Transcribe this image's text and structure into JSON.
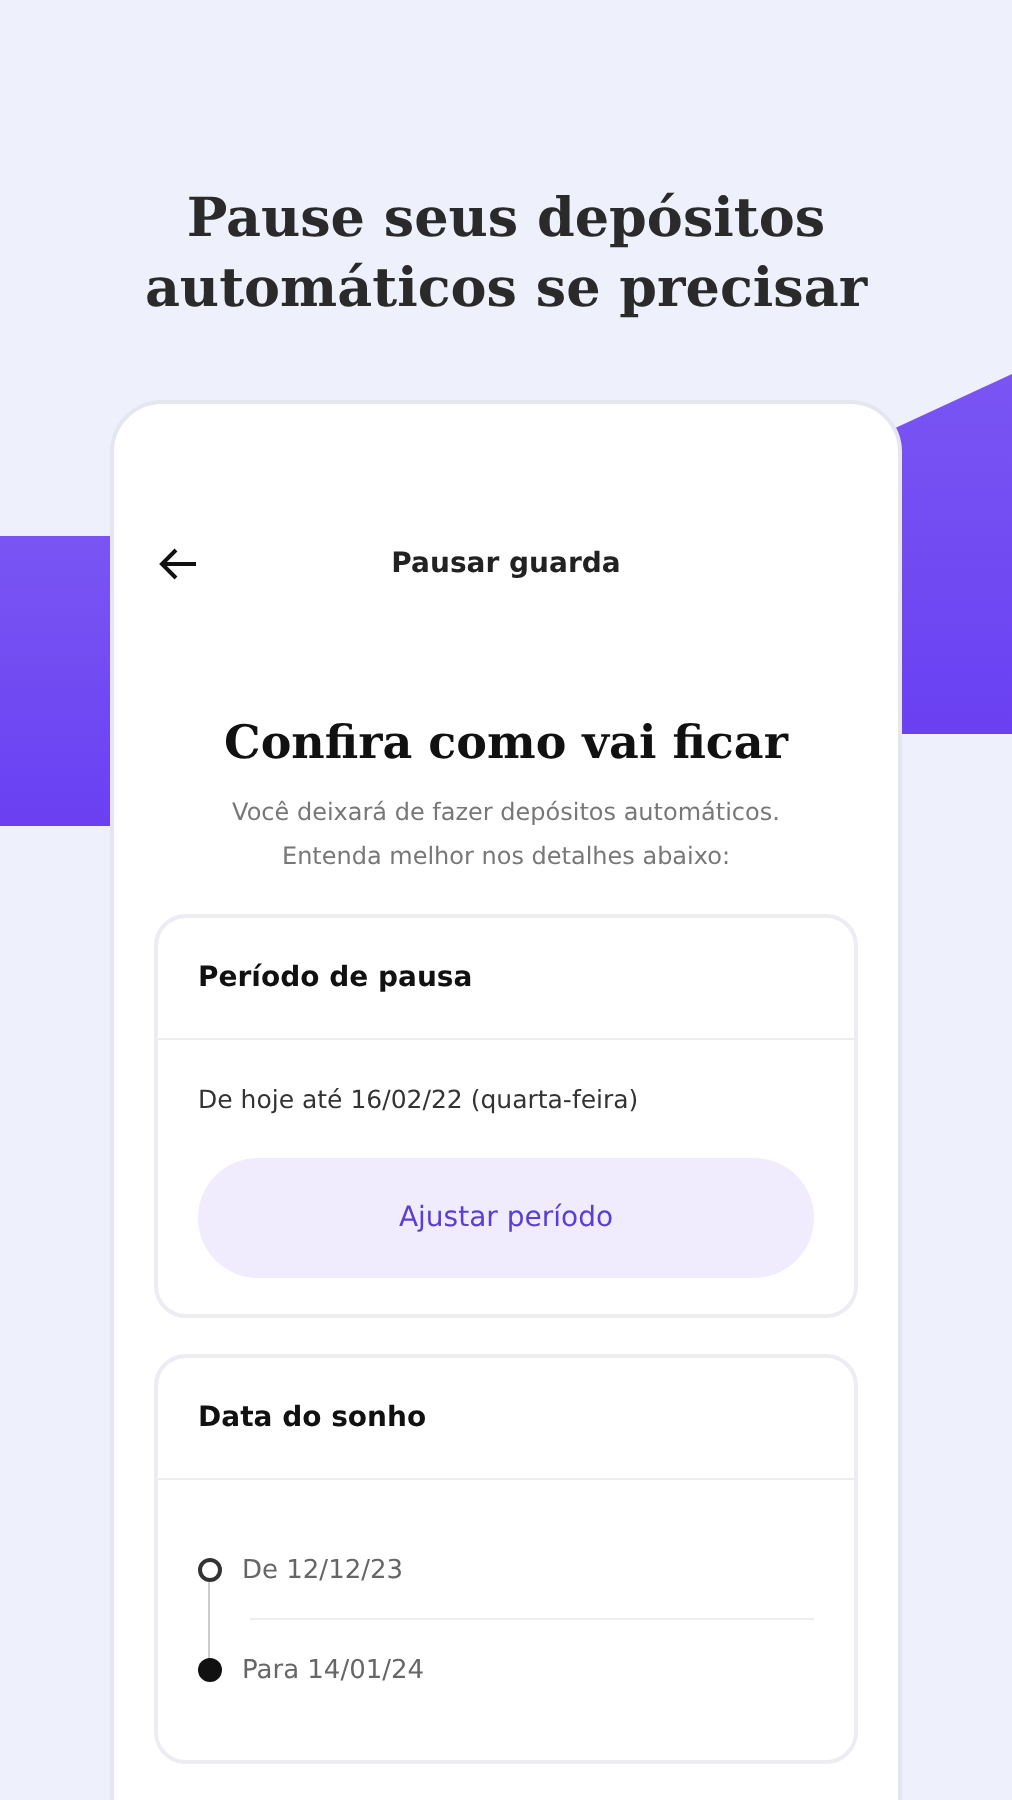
{
  "headline": "Pause seus depósitos automáticos se precisar",
  "screen": {
    "title": "Pausar guarda",
    "heading": "Confira como vai ficar",
    "subtitle": "Você deixará de fazer depósitos automáticos.\nEntenda melhor nos detalhes abaixo:",
    "pause_card": {
      "title": "Período de pausa",
      "text": "De hoje até 16/02/22 (quarta-feira)",
      "button": "Ajustar período"
    },
    "dream_card": {
      "title": "Data do sonho",
      "timeline": [
        {
          "kind": "start",
          "label": "De 12/12/23"
        },
        {
          "kind": "end",
          "label": "Para 14/01/24"
        }
      ]
    }
  }
}
